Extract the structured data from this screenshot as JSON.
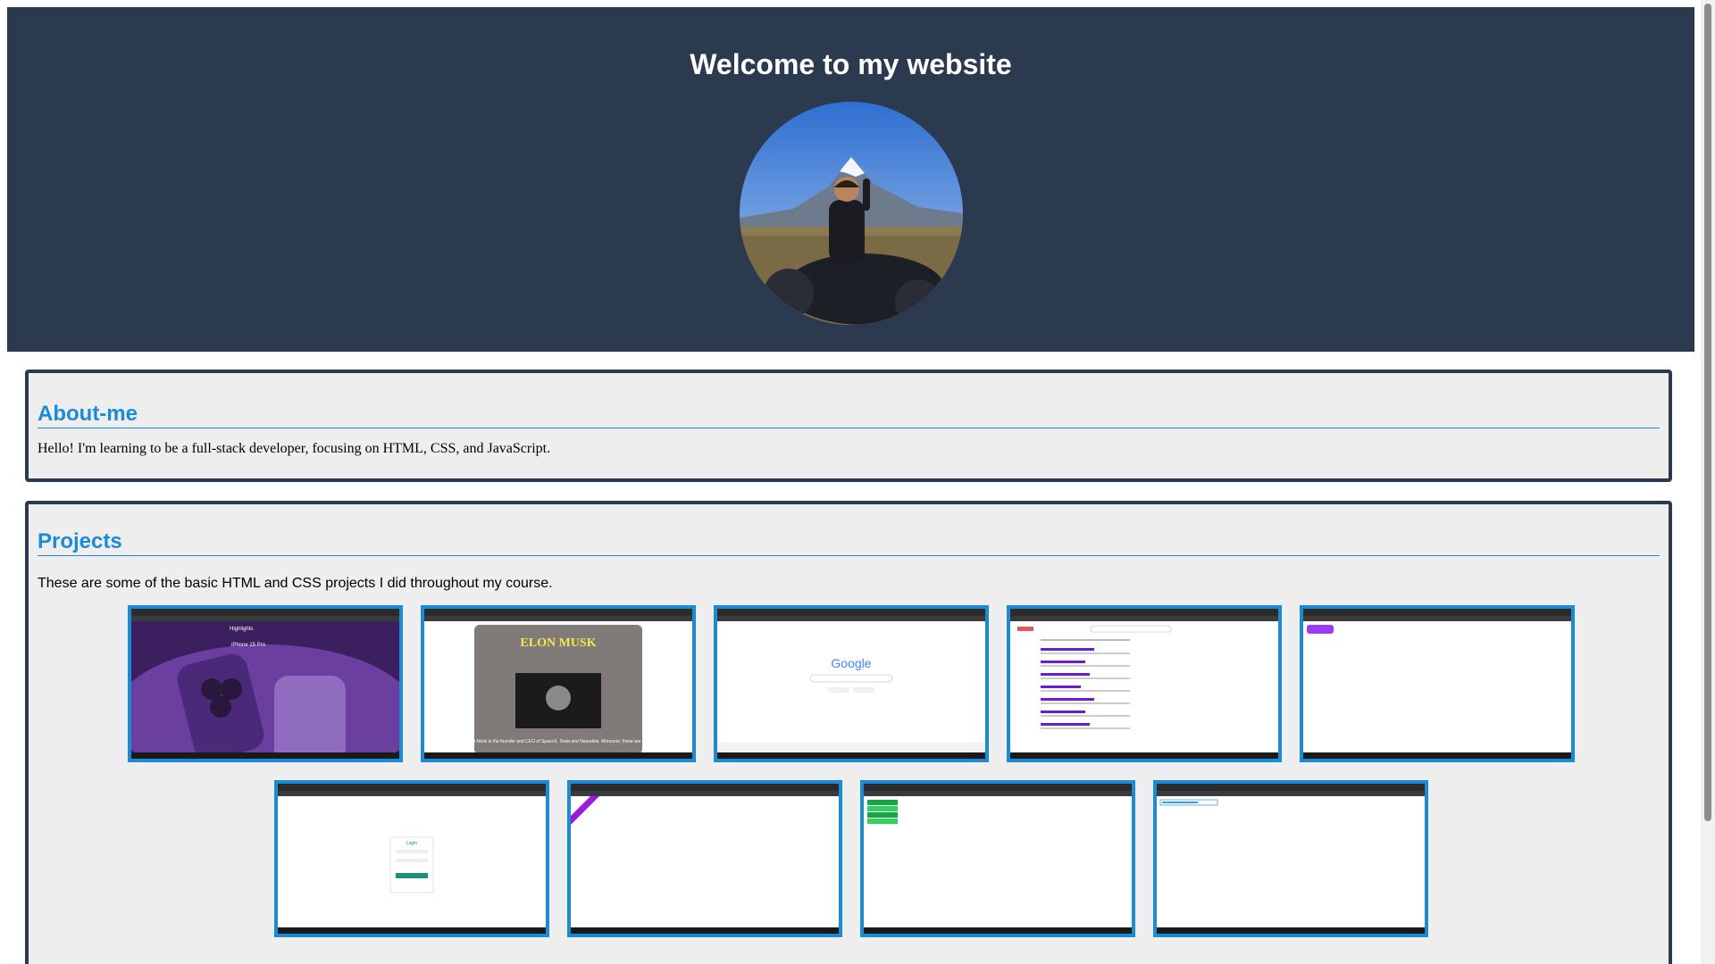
{
  "header": {
    "title": "Welcome to my website"
  },
  "about": {
    "heading": "About-me",
    "text": "Hello! I'm learning to be a full-stack developer, focusing on HTML, CSS, and JavaScript."
  },
  "projects": {
    "heading": "Projects",
    "text": "These are some of the basic HTML and CSS projects I did throughout my course.",
    "items": [
      {
        "name": "iphone-project",
        "visible_text": [
          "Highlights",
          "iPhone 15 Pro"
        ]
      },
      {
        "name": "elon-musk-project",
        "visible_text": [
          "ELON MUSK",
          "Elon Musk is the founder and CEO of SpaceX, Tesla and Neuralink. Moreover, these are only"
        ]
      },
      {
        "name": "google-clone-project",
        "visible_text": [
          "Google"
        ]
      },
      {
        "name": "search-results-project",
        "visible_text": []
      },
      {
        "name": "button-project",
        "visible_text": []
      },
      {
        "name": "login-form-project",
        "visible_text": [
          "Login"
        ]
      },
      {
        "name": "ribbon-project",
        "visible_text": []
      },
      {
        "name": "table-project",
        "visible_text": []
      },
      {
        "name": "form-input-project",
        "visible_text": []
      }
    ]
  },
  "colors": {
    "header_bg": "#2b3a4f",
    "accent": "#1b8bd6",
    "section_bg": "#eeeeee"
  }
}
